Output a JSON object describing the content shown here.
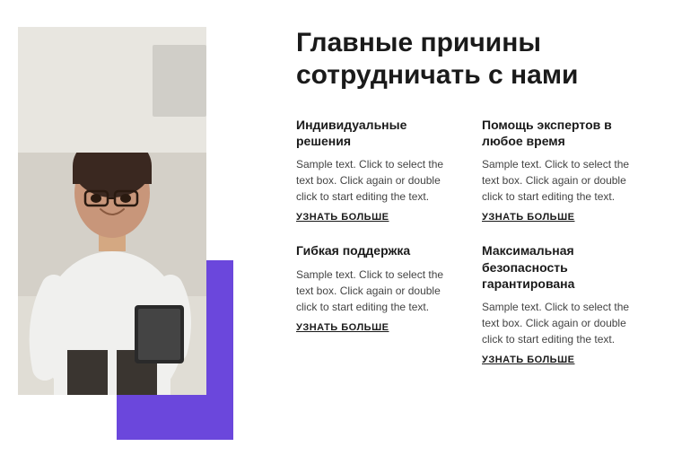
{
  "main_title": "Главные причины сотрудничать с нами",
  "features": [
    {
      "title": "Индивидуальные решения",
      "text": "Sample text. Click to select the text box. Click again or double click to start editing the text.",
      "link": "УЗНАТЬ БОЛЬШЕ"
    },
    {
      "title": "Помощь экспертов в любое время",
      "text": "Sample text. Click to select the text box. Click again or double click to start editing the text.",
      "link": "УЗНАТЬ БОЛЬШЕ"
    },
    {
      "title": "Гибкая поддержка",
      "text": "Sample text. Click to select the text box. Click again or double click to start editing the text.",
      "link": "УЗНАТЬ БОЛЬШЕ"
    },
    {
      "title": "Максимальная безопасность гарантирована",
      "text": "Sample text. Click to select the text box. Click again or double click to start editing the text.",
      "link": "УЗНАТЬ БОЛЬШЕ"
    }
  ],
  "colors": {
    "accent": "#6b47dc",
    "text_dark": "#1a1a1a",
    "text_gray": "#444444"
  }
}
